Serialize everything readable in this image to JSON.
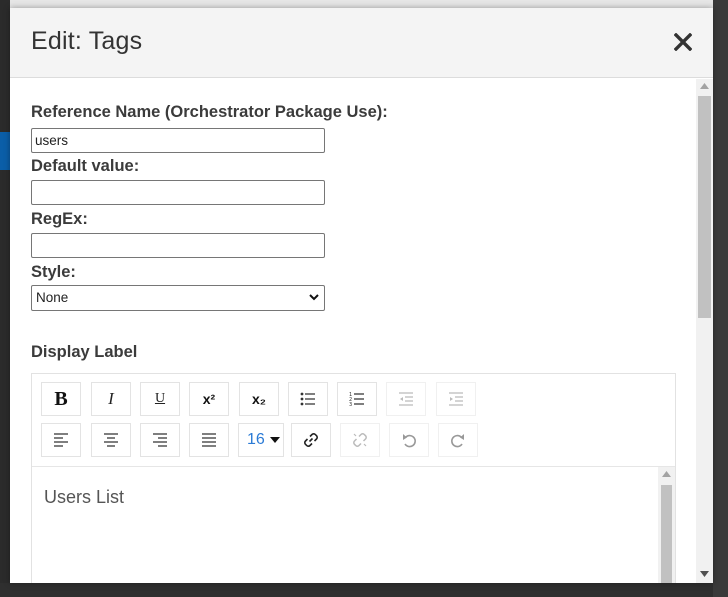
{
  "dialog": {
    "title": "Edit: Tags"
  },
  "form": {
    "reference_name": {
      "label": "Reference Name (Orchestrator Package Use):",
      "value": "users"
    },
    "default_value": {
      "label": "Default value:",
      "value": ""
    },
    "regex": {
      "label": "RegEx:",
      "value": ""
    },
    "style": {
      "label": "Style:",
      "selected": "None"
    },
    "display_label": {
      "label": "Display Label"
    }
  },
  "editor": {
    "font_size": "16",
    "content": "Users List",
    "toolbar_row1": [
      "bold-icon",
      "italic-icon",
      "underline-icon",
      "superscript-icon",
      "subscript-icon",
      "bulleted-list-icon",
      "numbered-list-icon",
      "outdent-icon",
      "indent-icon"
    ],
    "toolbar_row2": [
      "align-left-icon",
      "align-center-icon",
      "align-right-icon",
      "justify-icon",
      "font-size-dropdown",
      "link-icon",
      "unlink-icon",
      "undo-icon",
      "redo-icon"
    ],
    "glyphs": {
      "bold": "B",
      "italic": "I",
      "underline": "U",
      "superscript": "x²",
      "subscript": "x₂"
    }
  },
  "colors": {
    "header_bg": "#f4f4f4",
    "accent_font_size": "#2b7bd6",
    "text": "#333333"
  }
}
